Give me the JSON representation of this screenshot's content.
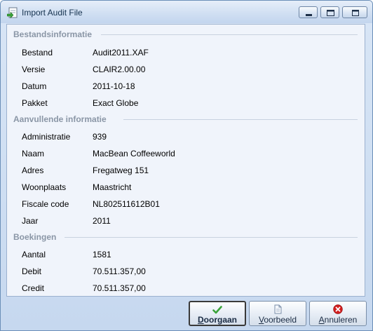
{
  "window": {
    "title": "Import Audit File"
  },
  "sections": {
    "file_info": {
      "title": "Bestandsinformatie",
      "rows": [
        {
          "label": "Bestand",
          "value": "Audit2011.XAF"
        },
        {
          "label": "Versie",
          "value": "CLAIR2.00.00"
        },
        {
          "label": "Datum",
          "value": "2011-10-18"
        },
        {
          "label": "Pakket",
          "value": "Exact Globe"
        }
      ]
    },
    "extra_info": {
      "title": "Aanvullende informatie",
      "rows": [
        {
          "label": "Administratie",
          "value": "939"
        },
        {
          "label": "Naam",
          "value": "MacBean Coffeeworld"
        },
        {
          "label": "Adres",
          "value": "Fregatweg 151"
        },
        {
          "label": "Woonplaats",
          "value": "Maastricht"
        },
        {
          "label": "Fiscale code",
          "value": "NL802511612B01"
        },
        {
          "label": "Jaar",
          "value": "2011"
        }
      ]
    },
    "bookings": {
      "title": "Boekingen",
      "rows": [
        {
          "label": "Aantal",
          "value": "1581"
        },
        {
          "label": "Debit",
          "value": "70.511.357,00"
        },
        {
          "label": "Credit",
          "value": "70.511.357,00"
        }
      ]
    }
  },
  "buttons": {
    "continue": {
      "first": "D",
      "rest": "oorgaan",
      "icon": "check-icon"
    },
    "preview": {
      "first": "V",
      "rest": "oorbeeld",
      "icon": "document-icon"
    },
    "cancel": {
      "first": "A",
      "rest": "nnuleren",
      "icon": "cancel-icon"
    }
  },
  "colors": {
    "accent_check": "#3aa33a",
    "cancel_red": "#d42020",
    "section_title": "#8a96a6"
  }
}
